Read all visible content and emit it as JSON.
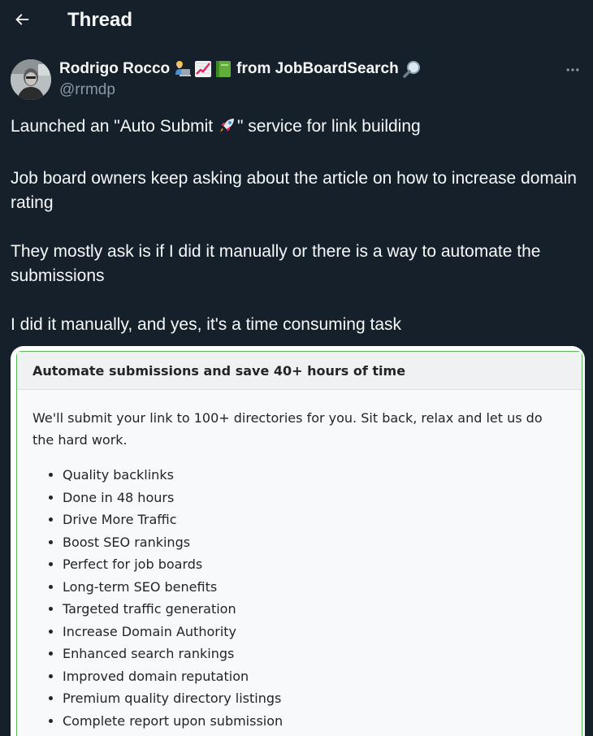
{
  "header": {
    "back_icon": "arrow-left-icon",
    "title": "Thread"
  },
  "author": {
    "name": "Rodrigo Rocco",
    "emojis": [
      "person-at-laptop-icon",
      "chart-increasing-icon",
      "green-book-icon"
    ],
    "name_suffix": "from JobBoardSearch",
    "suffix_emoji": "magnifying-glass-icon",
    "handle": "@rrmdp",
    "more_icon": "more-dots-icon"
  },
  "tweet": {
    "p1_before": "Launched an \"Auto Submit ",
    "p1_emoji": "rocket-icon",
    "p1_after": "\" service for link building",
    "p2": "Job board owners keep asking about the article on how to increase domain rating",
    "p3": "They mostly ask is if I did it manually or there is a way to automate the submissions",
    "p4": "I did it manually, and yes, it's a time consuming task"
  },
  "card": {
    "accent_color": "#5cb85c",
    "title": "Automate submissions and save 40+ hours of time",
    "intro": "We'll submit your link to 100+ directories for you. Sit back, relax and let us do the hard work.",
    "features": [
      "Quality backlinks",
      "Done in 48 hours",
      "Drive More Traffic",
      "Boost SEO rankings",
      "Perfect for job boards",
      "Long-term SEO benefits",
      "Targeted traffic generation",
      "Increase Domain Authority",
      "Enhanced search rankings",
      "Improved domain reputation",
      "Premium quality directory listings",
      "Complete report upon submission"
    ]
  },
  "colors": {
    "background": "#15202b",
    "text": "#f7f9f9",
    "secondary_text": "#8b98a5"
  }
}
